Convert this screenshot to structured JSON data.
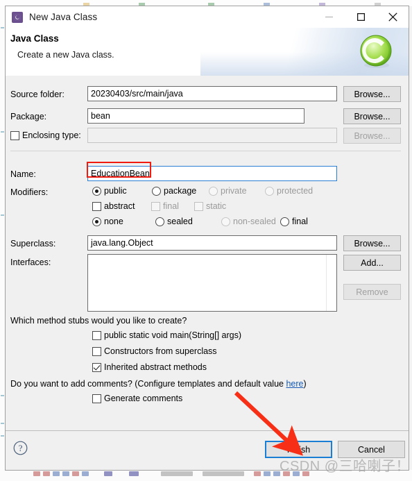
{
  "window": {
    "title": "New Java Class",
    "icon": "java-class-wizard-icon",
    "minimize_label": "—",
    "maximize_label": "□",
    "close_label": "✕"
  },
  "banner": {
    "heading": "Java Class",
    "subheading": "Create a new Java class.",
    "logo": "eclipse-c-logo"
  },
  "form": {
    "source_folder": {
      "label": "Source folder:",
      "value": "20230403/src/main/java",
      "browse_label": "Browse..."
    },
    "package": {
      "label": "Package:",
      "value": "bean",
      "browse_label": "Browse..."
    },
    "enclosing_type": {
      "label": "Enclosing type:",
      "value": "",
      "checked": false,
      "browse_label": "Browse...",
      "browse_enabled": false
    },
    "name": {
      "label": "Name:",
      "value": "EducationBean",
      "focused": true
    },
    "modifiers": {
      "label": "Modifiers:",
      "access": [
        {
          "label": "public",
          "selected": true,
          "enabled": true
        },
        {
          "label": "package",
          "selected": false,
          "enabled": true
        },
        {
          "label": "private",
          "selected": false,
          "enabled": false
        },
        {
          "label": "protected",
          "selected": false,
          "enabled": false
        }
      ],
      "flags": [
        {
          "label": "abstract",
          "checked": false,
          "enabled": true
        },
        {
          "label": "final",
          "checked": false,
          "enabled": false
        },
        {
          "label": "static",
          "checked": false,
          "enabled": false
        }
      ],
      "sealed": [
        {
          "label": "none",
          "selected": true,
          "enabled": true
        },
        {
          "label": "sealed",
          "selected": false,
          "enabled": true
        },
        {
          "label": "non-sealed",
          "selected": false,
          "enabled": false
        },
        {
          "label": "final",
          "selected": false,
          "enabled": true
        }
      ]
    },
    "superclass": {
      "label": "Superclass:",
      "value": "java.lang.Object",
      "browse_label": "Browse..."
    },
    "interfaces": {
      "label": "Interfaces:",
      "items": [],
      "add_label": "Add...",
      "remove_label": "Remove",
      "remove_enabled": false
    }
  },
  "stubs": {
    "question": "Which method stubs would you like to create?",
    "options": [
      {
        "label": "public static void main(String[] args)",
        "checked": false
      },
      {
        "label": "Constructors from superclass",
        "checked": false
      },
      {
        "label": "Inherited abstract methods",
        "checked": true
      }
    ]
  },
  "comments": {
    "question_prefix": "Do you want to add comments? (Configure templates and default value ",
    "link_label": "here",
    "question_suffix": ")",
    "option": {
      "label": "Generate comments",
      "checked": false
    }
  },
  "footer": {
    "help_icon": "question-mark-help-icon",
    "finish_label": "Finish",
    "cancel_label": "Cancel"
  },
  "annotations": {
    "name_highlight": "red-rectangle-around-name-value",
    "finish_arrow": "red-arrow-pointing-to-finish-button",
    "watermark": "CSDN @三哈喇子！"
  },
  "colors": {
    "accent_blue": "#1a7fd4",
    "annotation_red": "#f01b0e",
    "link_blue": "#1559b5",
    "dialog_bg": "#f0f0f0"
  }
}
